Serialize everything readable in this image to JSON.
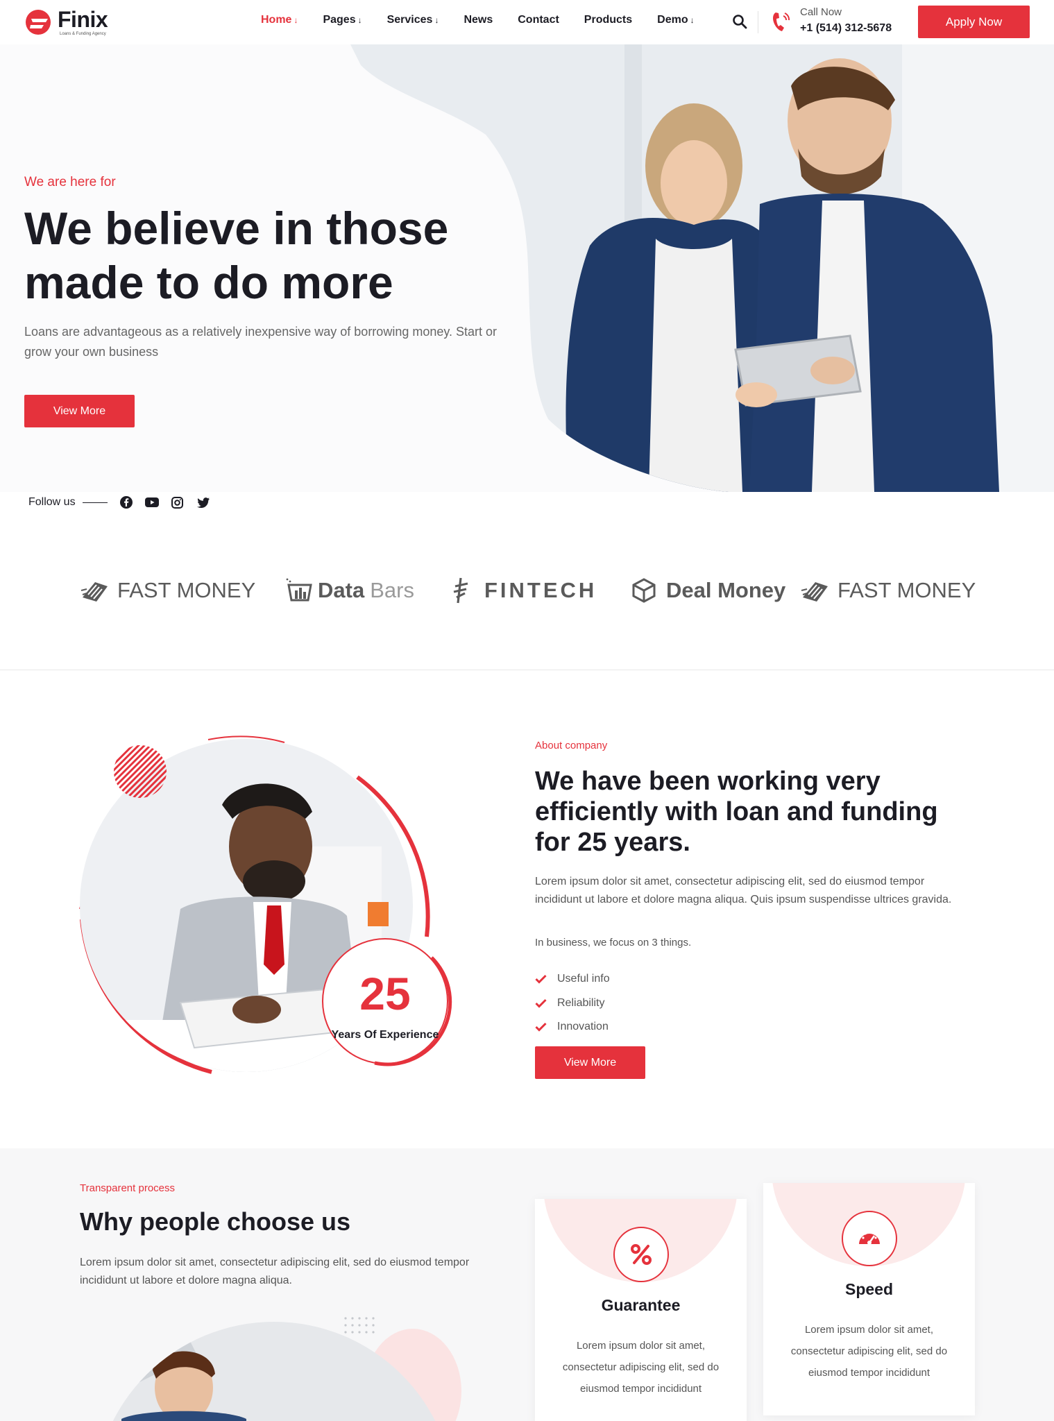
{
  "brand": {
    "name": "Finix",
    "tagline": "Loans & Funding Agency"
  },
  "nav": {
    "items": [
      {
        "label": "Home",
        "arrow": "↓"
      },
      {
        "label": "Pages",
        "arrow": "↓"
      },
      {
        "label": "Services",
        "arrow": "↓"
      },
      {
        "label": "News",
        "arrow": ""
      },
      {
        "label": "Contact",
        "arrow": ""
      },
      {
        "label": "Products",
        "arrow": ""
      },
      {
        "label": "Demo",
        "arrow": "↓"
      }
    ],
    "call_label": "Call Now",
    "call_number": "+1 (514) 312-5678",
    "apply_label": "Apply Now"
  },
  "hero": {
    "eyebrow": "We are here for",
    "title": "We believe in those made to do more",
    "description": "Loans are advantageous as a relatively inexpensive way of borrowing money. Start or grow your own business",
    "button_label": "View More"
  },
  "follow": {
    "label": "Follow us",
    "icons": [
      "facebook-icon",
      "youtube-icon",
      "instagram-icon",
      "twitter-icon"
    ]
  },
  "brands": [
    {
      "name": "FAST MONEY",
      "icon": "fast-money-icon"
    },
    {
      "name_main": "Data",
      "name_sub": "Bars",
      "icon": "data-bars-icon"
    },
    {
      "name": "FINTECH",
      "icon": "fintech-icon"
    },
    {
      "name": "Deal Money",
      "icon": "deal-money-icon"
    },
    {
      "name": "FAST MONEY",
      "icon": "fast-money-icon"
    }
  ],
  "about": {
    "eyebrow": "About company",
    "title": "We have been working very efficiently with loan and funding for 25 years.",
    "description": "Lorem ipsum dolor sit amet, consectetur adipiscing elit, sed do eiusmod tempor incididunt ut labore et dolore magna aliqua. Quis ipsum suspendisse ultrices gravida.",
    "focus_text": "In business, we focus on 3 things.",
    "list": [
      "Useful info",
      "Reliability",
      "Innovation"
    ],
    "button_label": "View More",
    "experience_number": "25",
    "experience_label": "Years Of Experience"
  },
  "why": {
    "eyebrow": "Transparent process",
    "title": "Why people choose us",
    "description": "Lorem ipsum dolor sit amet, consectetur adipiscing elit, sed do eiusmod tempor incididunt ut labore et dolore magna aliqua.",
    "cards": [
      {
        "title": "Guarantee",
        "icon": "percent-icon",
        "description": "Lorem ipsum dolor sit amet, consectetur adipiscing elit, sed do eiusmod tempor incididunt"
      },
      {
        "title": "Speed",
        "icon": "speedometer-icon",
        "description": "Lorem ipsum dolor sit amet, consectetur adipiscing elit, sed do eiusmod tempor incididunt"
      }
    ]
  },
  "colors": {
    "accent": "#e5323c",
    "dark": "#1c1c24",
    "navy": "#1f3a68"
  }
}
